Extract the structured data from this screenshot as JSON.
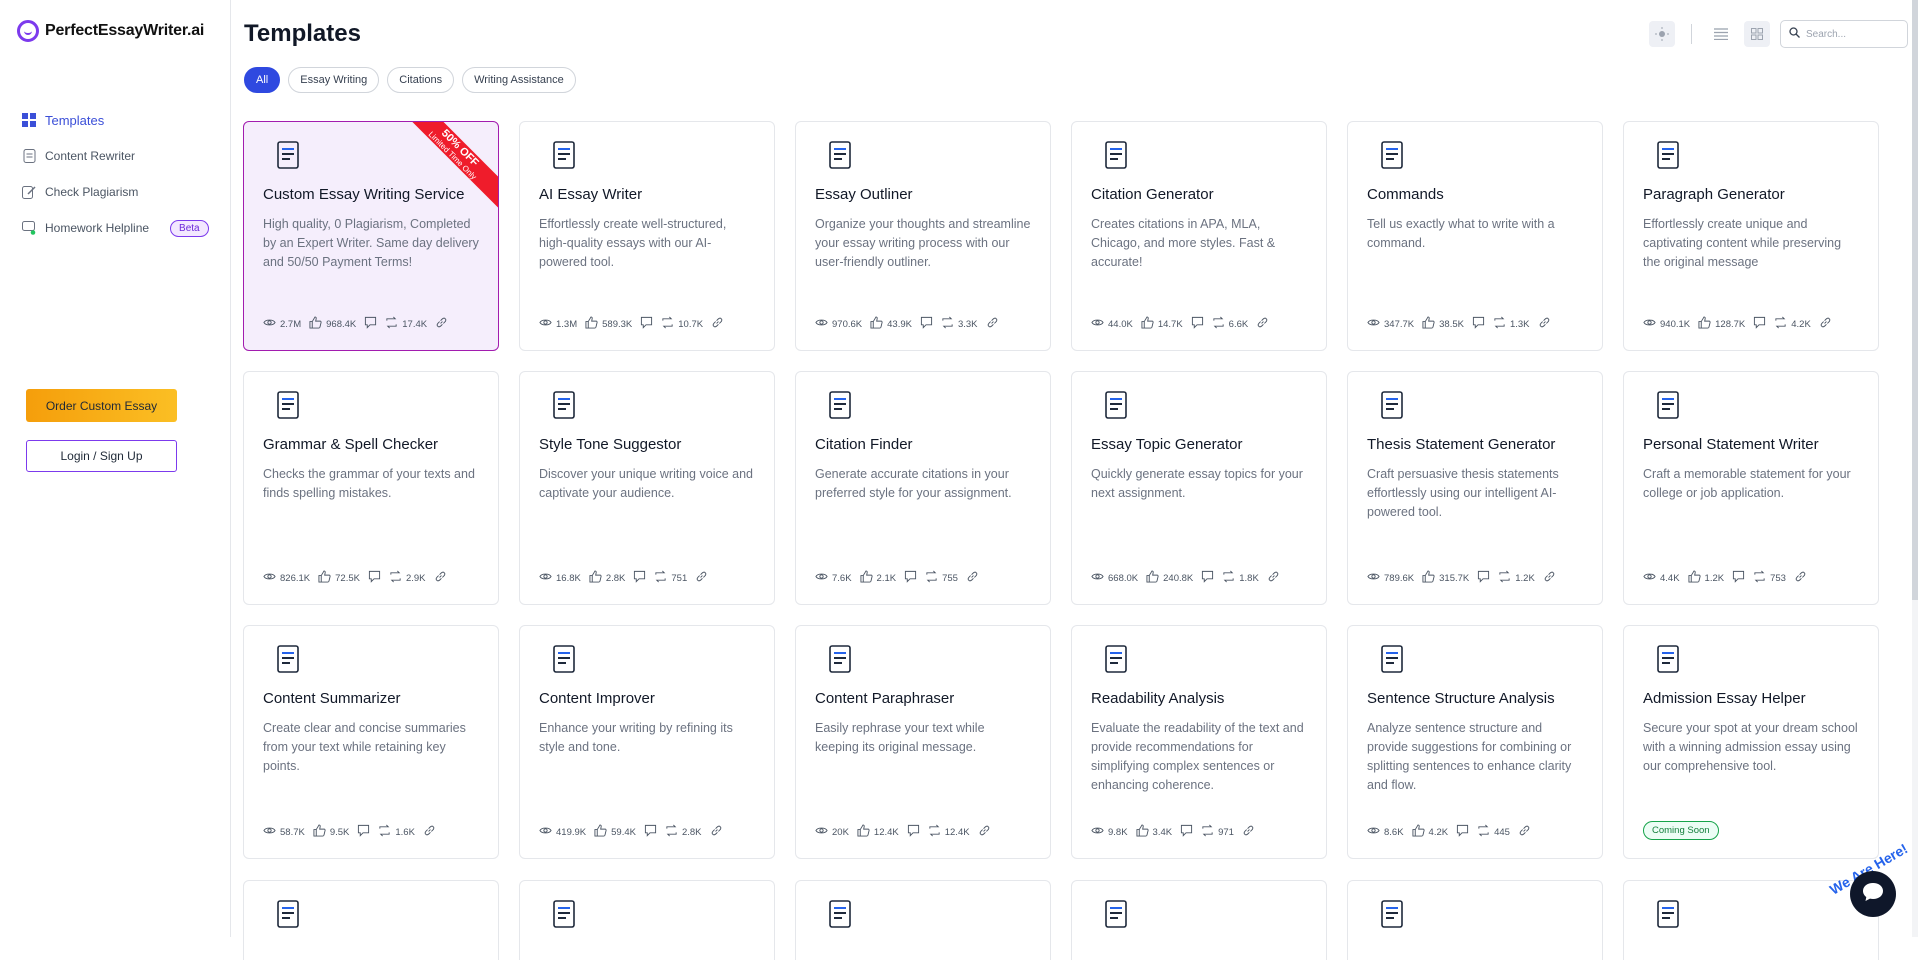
{
  "brand": {
    "name": "PerfectEssayWriter.ai"
  },
  "sidebar": {
    "items": [
      {
        "label": "Templates",
        "icon": "grid-icon",
        "active": true
      },
      {
        "label": "Content Rewriter",
        "icon": "document-icon",
        "active": false
      },
      {
        "label": "Check Plagiarism",
        "icon": "edit-icon",
        "active": false
      },
      {
        "label": "Homework Helpline",
        "icon": "chat-user-icon",
        "active": false,
        "badge": "Beta"
      }
    ],
    "order_button": "Order Custom Essay",
    "login_button": "Login / Sign Up"
  },
  "header": {
    "title": "Templates",
    "filters": [
      "All",
      "Essay Writing",
      "Citations",
      "Writing Assistance"
    ],
    "active_filter": "All",
    "search_placeholder": "Search..."
  },
  "cards": [
    {
      "title": "Custom Essay Writing Service",
      "desc": "High quality, 0 Plagiarism, Completed by an Expert Writer. Same day delivery and 50/50 Payment Terms!",
      "views": "2.7M",
      "likes": "968.4K",
      "shares": "17.4K",
      "featured": true,
      "ribbon": "50% OFF",
      "ribbon_sub": "Limited Time Only",
      "icon": "essay-pen-icon"
    },
    {
      "title": "AI Essay Writer",
      "desc": "Effortlessly create well-structured, high-quality essays with our AI-powered tool.",
      "views": "1.3M",
      "likes": "589.3K",
      "shares": "10.7K",
      "icon": "pen-nib-icon"
    },
    {
      "title": "Essay Outliner",
      "desc": "Organize your thoughts and streamline your essay writing process with our user-friendly outliner.",
      "views": "970.6K",
      "likes": "43.9K",
      "shares": "3.3K",
      "icon": "outline-doc-icon"
    },
    {
      "title": "Citation Generator",
      "desc": "Creates citations in APA, MLA, Chicago, and more styles. Fast & accurate!",
      "views": "44.0K",
      "likes": "14.7K",
      "shares": "6.6K",
      "icon": "quote-icon"
    },
    {
      "title": "Commands",
      "desc": "Tell us exactly what to write with a command.",
      "views": "347.7K",
      "likes": "38.5K",
      "shares": "1.3K",
      "icon": "voice-user-icon"
    },
    {
      "title": "Paragraph Generator",
      "desc": "Effortlessly create unique and captivating content while preserving the original message",
      "views": "940.1K",
      "likes": "128.7K",
      "shares": "4.2K",
      "icon": "paragraph-icon"
    },
    {
      "title": "Grammar & Spell Checker",
      "desc": "Checks the grammar of your texts and finds spelling mistakes.",
      "views": "826.1K",
      "likes": "72.5K",
      "shares": "2.9K",
      "icon": "grammar-check-icon"
    },
    {
      "title": "Style Tone Suggestor",
      "desc": "Discover your unique writing voice and captivate your audience.",
      "views": "16.8K",
      "likes": "2.8K",
      "shares": "751",
      "icon": "tone-doc-icon"
    },
    {
      "title": "Citation Finder",
      "desc": "Generate accurate citations in your preferred style for your assignment.",
      "views": "7.6K",
      "likes": "2.1K",
      "shares": "755",
      "icon": "citation-doc-icon"
    },
    {
      "title": "Essay Topic Generator",
      "desc": "Quickly generate essay topics for your next assignment.",
      "views": "668.0K",
      "likes": "240.8K",
      "shares": "1.8K",
      "icon": "topic-search-icon"
    },
    {
      "title": "Thesis Statement Generator",
      "desc": "Craft persuasive thesis statements effortlessly using our intelligent AI-powered tool.",
      "views": "789.6K",
      "likes": "315.7K",
      "shares": "1.2K",
      "icon": "graduation-book-icon"
    },
    {
      "title": "Personal Statement Writer",
      "desc": "Craft a memorable statement for your college or job application.",
      "views": "4.4K",
      "likes": "1.2K",
      "shares": "753",
      "icon": "person-doc-icon"
    },
    {
      "title": "Content Summarizer",
      "desc": "Create clear and concise summaries from your text while retaining key points.",
      "views": "58.7K",
      "likes": "9.5K",
      "shares": "1.6K",
      "icon": "monitor-pen-icon"
    },
    {
      "title": "Content Improver",
      "desc": "Enhance your writing by refining its style and tone.",
      "views": "419.9K",
      "likes": "59.4K",
      "shares": "2.8K",
      "icon": "gear-doc-icon"
    },
    {
      "title": "Content Paraphraser",
      "desc": "Easily rephrase your text while keeping its original message.",
      "views": "20K",
      "likes": "12.4K",
      "shares": "12.4K",
      "icon": "clipboard-gear-icon"
    },
    {
      "title": "Readability Analysis",
      "desc": "Evaluate the readability of the text and provide recommendations for simplifying complex sentences or enhancing coherence.",
      "views": "9.8K",
      "likes": "3.4K",
      "shares": "971",
      "icon": "readability-icon"
    },
    {
      "title": "Sentence Structure Analysis",
      "desc": "Analyze sentence structure and provide suggestions for combining or splitting sentences to enhance clarity and flow.",
      "views": "8.6K",
      "likes": "4.2K",
      "shares": "445",
      "icon": "structure-doc-icon"
    },
    {
      "title": "Admission Essay Helper",
      "desc": "Secure your spot at your dream school with a winning admission essay using our comprehensive tool.",
      "views": "",
      "likes": "",
      "shares": "",
      "coming_soon": "Coming Soon",
      "icon": "cap-book-icon"
    }
  ],
  "peek_icons": [
    "list-doc-icon",
    "chart-search-icon",
    "lab-doc-icon",
    "cap-screen-icon",
    "quote-doc-icon",
    "presentation-icon"
  ],
  "chat": {
    "label": "We Are Here!"
  },
  "colors": {
    "accent": "#2f49e0",
    "featured_bg": "#f5eefc",
    "featured_border": "#a21caf",
    "ribbon": "#ef1c2b",
    "order": "#f59e0b"
  }
}
